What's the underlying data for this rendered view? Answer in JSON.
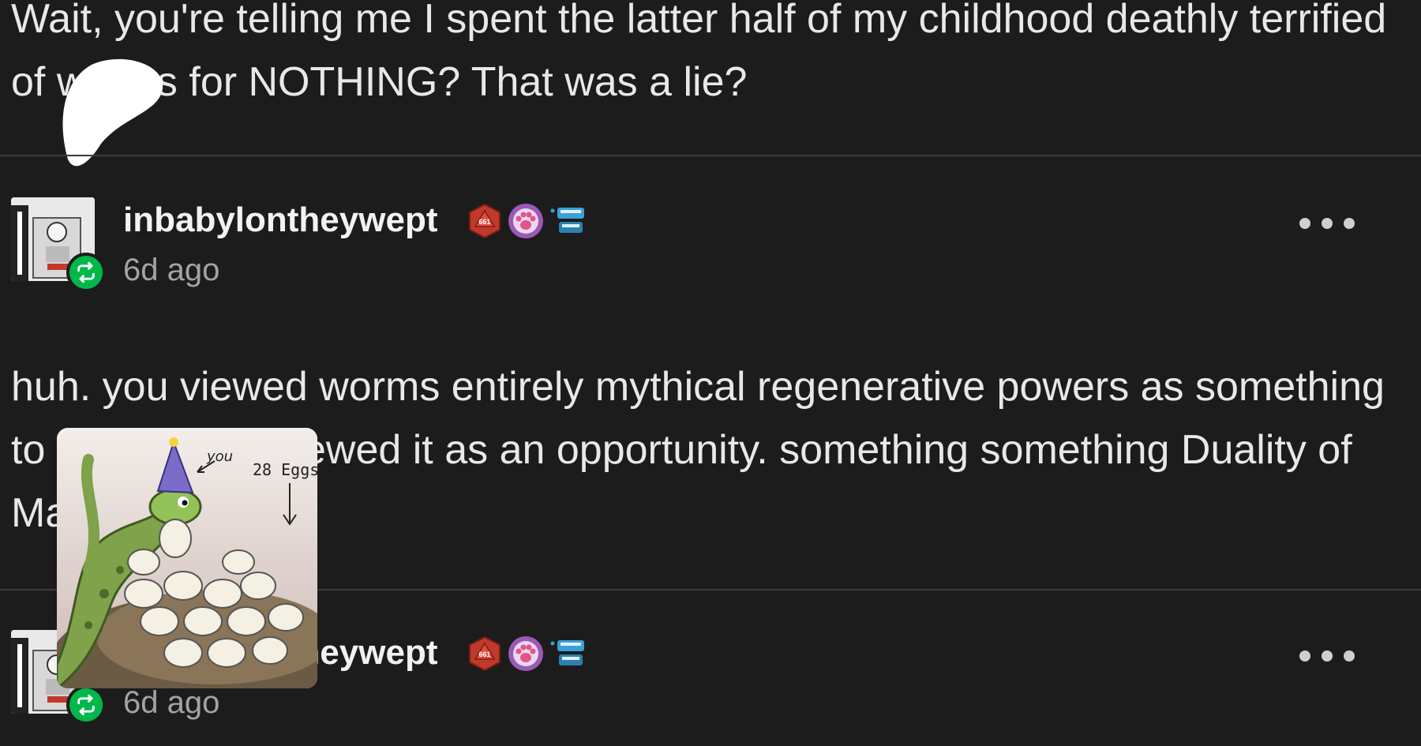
{
  "post": {
    "intro_text": "Wait, you're telling me I spent the latter half of my childhood deathly terrified of worms for NOTHING? That was a lie?"
  },
  "reblogs": [
    {
      "username": "inbabylontheywept",
      "timestamp": "6d ago",
      "badges": [
        "d20-dice-badge",
        "paw-badge",
        "teeth-badge"
      ]
    },
    {
      "username": "inbabylontheywept",
      "timestamp": "6d ago",
      "badges": [
        "d20-dice-badge",
        "paw-badge",
        "teeth-badge"
      ]
    }
  ],
  "reply": {
    "text": "huh. you viewed worms entirely mythical regenerative powers as something to be feared. i viewed it as an opportunity. something something Duality of Man."
  },
  "sticker": {
    "label_you": "you",
    "label_eggs": "28 Eggs"
  },
  "icons": {
    "more": "more-options-icon",
    "reblog": "reblog-icon"
  },
  "colors": {
    "background": "#1c1c1c",
    "reblog_green": "#00b84a",
    "dice_red": "#c0392b",
    "paw_purple": "#9b59b6",
    "teeth_blue": "#3aa0d8"
  }
}
